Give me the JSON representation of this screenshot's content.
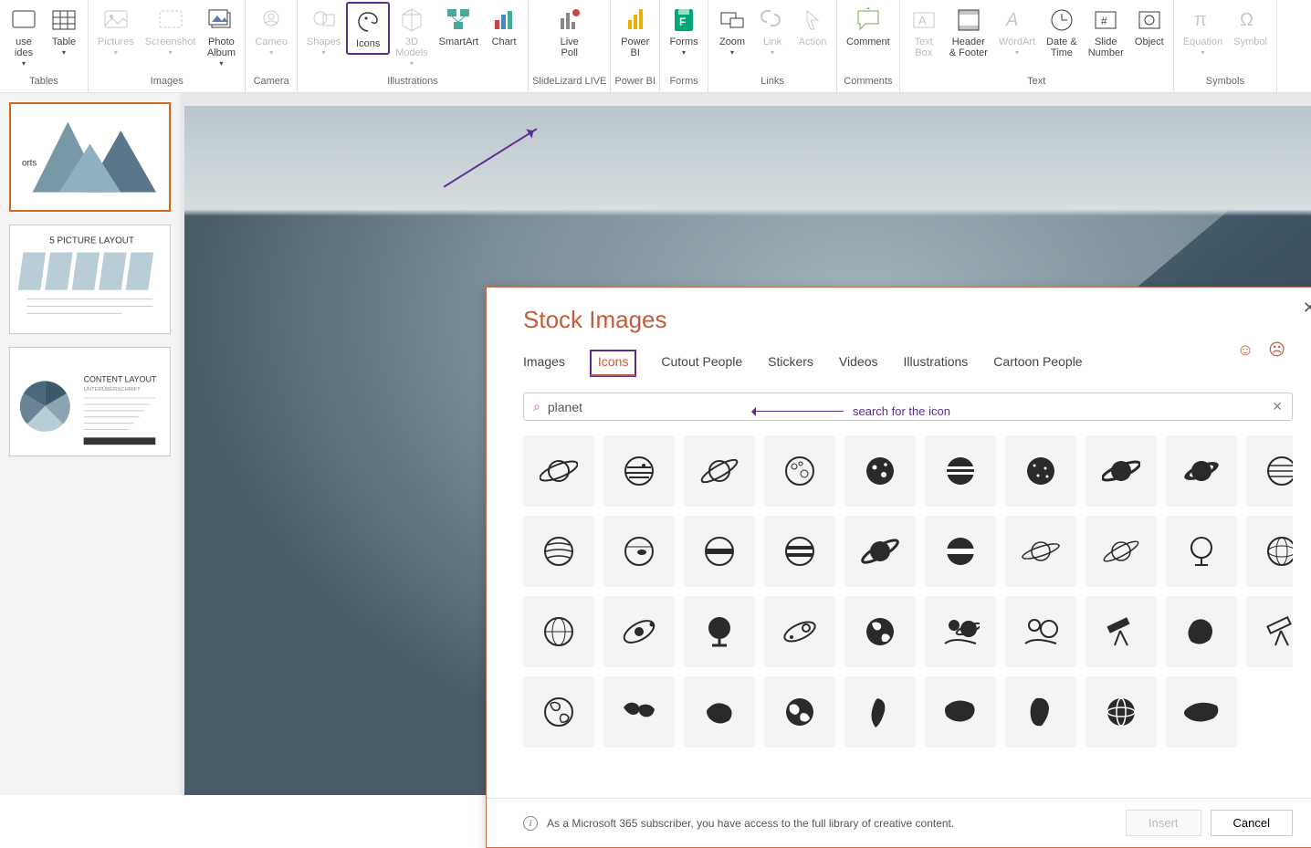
{
  "ribbon": {
    "groups": [
      {
        "label": "Tables",
        "items": [
          {
            "id": "use-slides",
            "label": "use\nides",
            "drop": true,
            "disabled": false
          },
          {
            "id": "table",
            "label": "Table",
            "drop": true
          }
        ]
      },
      {
        "label": "Images",
        "items": [
          {
            "id": "pictures",
            "label": "Pictures",
            "drop": true,
            "disabled": true
          },
          {
            "id": "screenshot",
            "label": "Screenshot",
            "drop": true,
            "disabled": true
          },
          {
            "id": "photo-album",
            "label": "Photo\nAlbum",
            "drop": true
          }
        ]
      },
      {
        "label": "Camera",
        "items": [
          {
            "id": "cameo",
            "label": "Cameo",
            "drop": true,
            "disabled": true
          }
        ]
      },
      {
        "label": "Illustrations",
        "items": [
          {
            "id": "shapes",
            "label": "Shapes",
            "drop": true,
            "disabled": true
          },
          {
            "id": "icons",
            "label": "Icons",
            "highlight": true
          },
          {
            "id": "3d-models",
            "label": "3D\nModels",
            "drop": true,
            "disabled": true
          },
          {
            "id": "smartart",
            "label": "SmartArt"
          },
          {
            "id": "chart",
            "label": "Chart"
          }
        ]
      },
      {
        "label": "SlideLizard LIVE",
        "items": [
          {
            "id": "live-poll",
            "label": "Live\nPoll"
          }
        ]
      },
      {
        "label": "Power BI",
        "items": [
          {
            "id": "power-bi",
            "label": "Power\nBI"
          }
        ]
      },
      {
        "label": "Forms",
        "items": [
          {
            "id": "forms",
            "label": "Forms",
            "drop": true
          }
        ]
      },
      {
        "label": "Links",
        "items": [
          {
            "id": "zoom",
            "label": "Zoom",
            "drop": true
          },
          {
            "id": "link",
            "label": "Link",
            "drop": true,
            "disabled": true
          },
          {
            "id": "action",
            "label": "Action",
            "disabled": true
          }
        ]
      },
      {
        "label": "Comments",
        "items": [
          {
            "id": "comment",
            "label": "Comment"
          }
        ]
      },
      {
        "label": "Text",
        "items": [
          {
            "id": "text-box",
            "label": "Text\nBox",
            "disabled": true
          },
          {
            "id": "header-footer",
            "label": "Header\n& Footer"
          },
          {
            "id": "wordart",
            "label": "WordArt",
            "drop": true,
            "disabled": true
          },
          {
            "id": "date-time",
            "label": "Date &\nTime"
          },
          {
            "id": "slide-number",
            "label": "Slide\nNumber"
          },
          {
            "id": "object",
            "label": "Object"
          }
        ]
      },
      {
        "label": "Symbols",
        "items": [
          {
            "id": "equation",
            "label": "Equation",
            "drop": true,
            "disabled": true
          },
          {
            "id": "symbol",
            "label": "Symbol",
            "disabled": true
          }
        ]
      }
    ]
  },
  "thumbnails": [
    {
      "title": "orts",
      "active": true,
      "kind": "mountain"
    },
    {
      "title": "5 PICTURE LAYOUT",
      "kind": "pictures"
    },
    {
      "title": "CONTENT LAYOUT",
      "subtitle": "UNTERÜBERSCHRIFT",
      "kind": "pie"
    }
  ],
  "dialog": {
    "title": "Stock Images",
    "tabs": [
      "Images",
      "Icons",
      "Cutout People",
      "Stickers",
      "Videos",
      "Illustrations",
      "Cartoon People"
    ],
    "active_tab": "Icons",
    "search_value": "planet",
    "search_annotation": "search for the icon",
    "footer_text": "As a Microsoft 365 subscriber, you have access to the full library of creative content.",
    "insert_label": "Insert",
    "cancel_label": "Cancel",
    "icons": [
      "saturn-outline",
      "planet-stripes-outline",
      "saturn-outline-tilt",
      "moon-craters-outline",
      "planet-dots-filled",
      "planet-stripes-filled-h",
      "planet-dots-dark",
      "saturn-filled",
      "saturn-ring-filled",
      "jupiter-outline",
      "planet-lines-outline",
      "planet-spot-outline",
      "planet-band-outline",
      "planet-band-outline-2",
      "saturn-filled-tilt",
      "planet-band-filled",
      "saturn-outline-thin",
      "saturn-outline-thin-2",
      "globe-stand-outline",
      "globe-wire-outline",
      "globe-wire-simple",
      "orbit-outline",
      "globe-stand-filled",
      "orbit-ellipse",
      "earth-filled",
      "planets-scene-filled",
      "planets-scene-outline",
      "telescope-filled",
      "antarctica-filled",
      "telescope-outline",
      "earth-outline",
      "world-map-filled",
      "australia-filled",
      "earth-filled-2",
      "south-america-filled",
      "asia-filled",
      "africa-filled",
      "globe-2-filled",
      "eurasia-filled",
      ""
    ]
  }
}
